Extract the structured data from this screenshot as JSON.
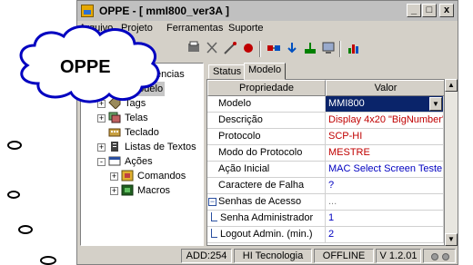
{
  "window": {
    "title": "OPPE - [ mmI800_ver3A ]",
    "controls": {
      "minimize": "_",
      "maximize": "□",
      "close": "x"
    }
  },
  "menu": [
    {
      "label": "Arquivo"
    },
    {
      "label": "Projeto"
    },
    {
      "label": "Ferramentas"
    },
    {
      "label": "Suporte"
    }
  ],
  "callout": {
    "text": "OPPE"
  },
  "tree": {
    "items": [
      {
        "label": "Preferências",
        "expand": ""
      },
      {
        "label": "Modelo",
        "expand": "",
        "selected": true
      },
      {
        "label": "Tags",
        "expand": "+"
      },
      {
        "label": "Telas",
        "expand": "+"
      },
      {
        "label": "Teclado",
        "expand": ""
      },
      {
        "label": "Listas de Textos",
        "expand": "+"
      },
      {
        "label": "Ações",
        "expand": "-"
      },
      {
        "label": "Comandos",
        "expand": "+"
      },
      {
        "label": "Macros",
        "expand": "+"
      }
    ]
  },
  "tabs": [
    {
      "label": "Status",
      "active": false
    },
    {
      "label": "Modelo",
      "active": true
    }
  ],
  "grid": {
    "headers": {
      "property": "Propriedade",
      "value": "Valor"
    },
    "rows": [
      {
        "property": "Modelo",
        "value": "MMI800",
        "style": "combo"
      },
      {
        "property": "Descrição",
        "value": "Display 4x20 \"BigNumber\" -",
        "style": "red"
      },
      {
        "property": "Protocolo",
        "value": "SCP-HI",
        "style": "red"
      },
      {
        "property": "Modo do Protocolo",
        "value": "MESTRE",
        "style": "red"
      },
      {
        "property": "Ação Inicial",
        "value": "MAC Select Screen Teste 1",
        "style": "blue"
      },
      {
        "property": "Caractere de Falha",
        "value": "?",
        "style": "blue"
      },
      {
        "property": "Senhas de Acesso",
        "value": "...",
        "style": "group"
      },
      {
        "property": "Senha Administrador",
        "value": "1",
        "style": "child"
      },
      {
        "property": "Logout Admin. (min.)",
        "value": "2",
        "style": "child"
      }
    ]
  },
  "status": {
    "address": "ADD:254",
    "company": "HI Tecnologia",
    "connection": "OFFLINE",
    "version": "V 1.2.01"
  },
  "colors": {
    "selection": "#0a246a",
    "value_red": "#c00000",
    "value_blue": "#0000c0"
  }
}
